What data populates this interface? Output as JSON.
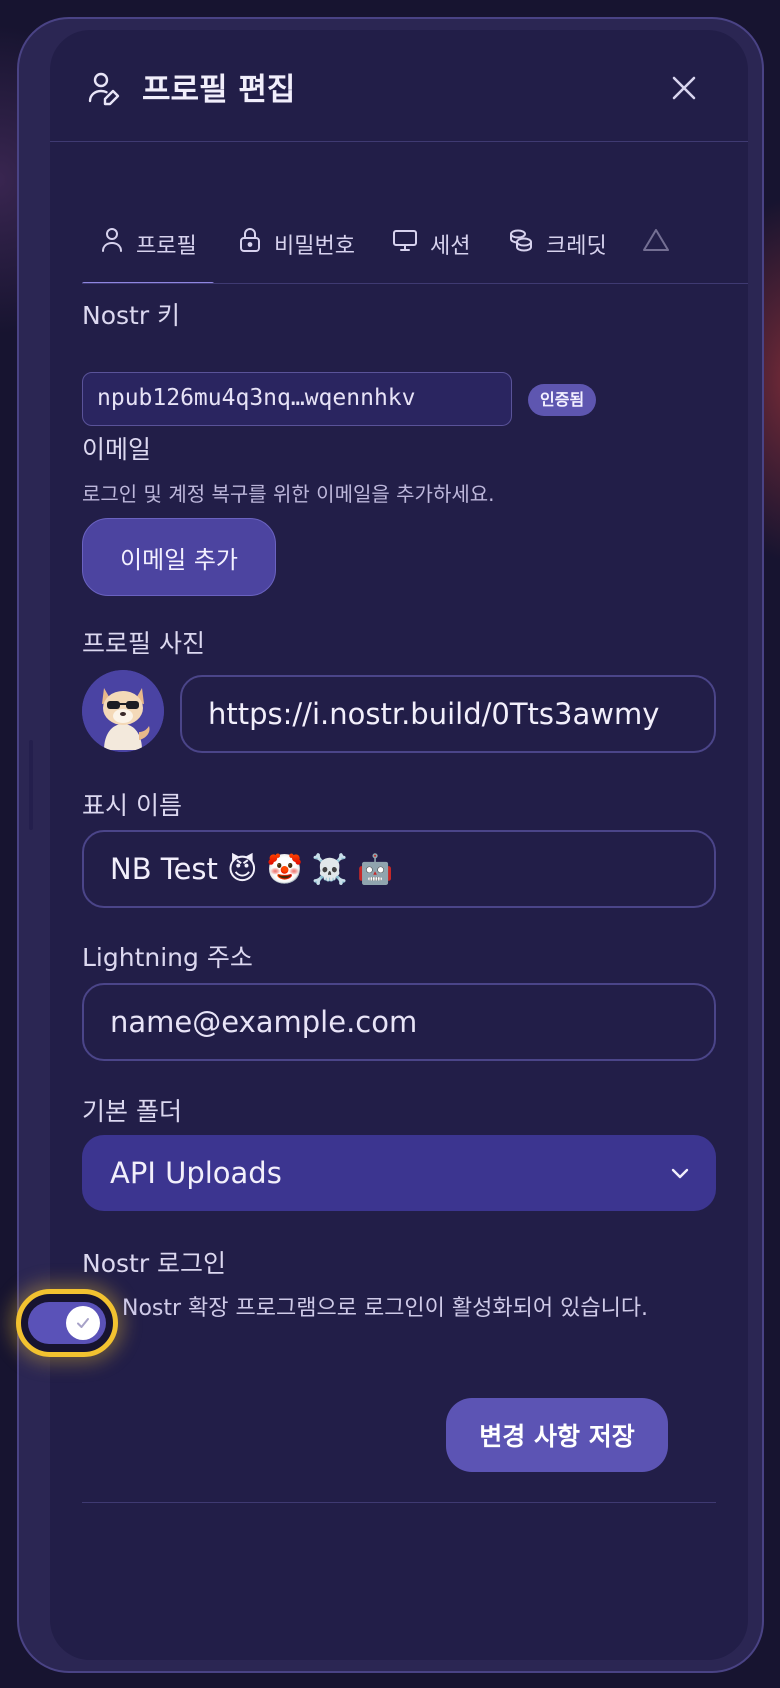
{
  "header": {
    "title": "프로필 편집",
    "icon": "user-edit-icon",
    "close_icon": "close-icon"
  },
  "tabs": [
    {
      "label": "프로필",
      "icon": "user-icon",
      "active": true
    },
    {
      "label": "비밀번호",
      "icon": "lock-icon",
      "active": false
    },
    {
      "label": "세션",
      "icon": "monitor-icon",
      "active": false
    },
    {
      "label": "크레딧",
      "icon": "coins-icon",
      "active": false
    },
    {
      "label": "",
      "icon": "warning-icon",
      "active": false
    }
  ],
  "nostr_key": {
    "label": "Nostr 키",
    "value": "npub126mu4q3nq…wqennhkv",
    "badge": "인증됨"
  },
  "email": {
    "label": "이메일",
    "help": "로그인 및 계정 복구를 위한 이메일을 추가하세요.",
    "button": "이메일 추가"
  },
  "profile_picture": {
    "label": "프로필 사진",
    "url": "https://i.nostr.build/0Tts3awmy"
  },
  "display_name": {
    "label": "표시 이름",
    "value": "NB Test 😈 🤡 ☠️ 🤖"
  },
  "lightning": {
    "label": "Lightning 주소",
    "placeholder": "name@example.com"
  },
  "default_folder": {
    "label": "기본 폴더",
    "value": "API Uploads"
  },
  "nostr_login": {
    "label": "Nostr 로그인",
    "enabled": true,
    "description": "Nostr 확장 프로그램으로 로그인이 활성화되어 있습니다."
  },
  "save_button": "변경 사항 저장",
  "colors": {
    "accent": "#5c54b4",
    "focus_ring": "#f2c230",
    "background": "#221e48"
  }
}
